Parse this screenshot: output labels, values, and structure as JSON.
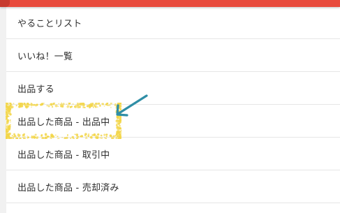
{
  "menu": {
    "items": [
      {
        "label": "やることリスト"
      },
      {
        "label": "いいね！一覧"
      },
      {
        "label": "出品する"
      },
      {
        "label": "出品した商品 - 出品中"
      },
      {
        "label": "出品した商品 - 取引中"
      },
      {
        "label": "出品した商品 - 売却済み"
      }
    ]
  },
  "annotation": {
    "highlight_color": "#f3d64a",
    "arrow_color": "#2f8ea6",
    "arrow_icon": "arrow-down-left-icon"
  },
  "header": {
    "color": "#e84a3c"
  }
}
